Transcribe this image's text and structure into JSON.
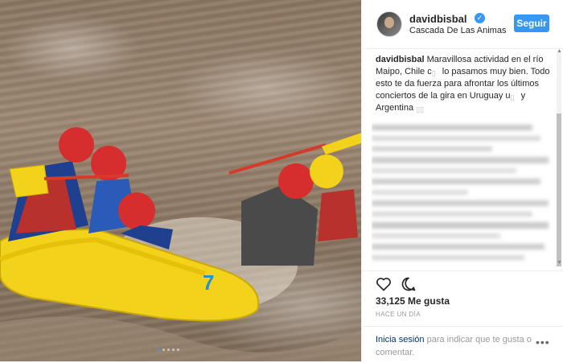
{
  "post": {
    "username": "davidbisbal",
    "verified_icon": "verified-badge-icon",
    "location": "Cascada De Las Animas",
    "follow_label": "Seguir",
    "caption_user": "davidbisbal",
    "caption_part1": "Maravillosa actividad en el río Maipo, Chile c",
    "caption_part2": " lo pasamos muy bien. Todo esto te da fuerza para afrontar los últimos conciertos de la gira en Uruguay u",
    "caption_part3": " y Argentina",
    "likes": "33,125 Me gusta",
    "time": "HACE UN DÍA",
    "login_link": "Inicia sesión",
    "login_text": " para indicar que te gusta o comentar.",
    "more_label": "•••"
  },
  "carousel": {
    "count": 5,
    "active": 0
  },
  "colors": {
    "accent": "#3897f0",
    "raft": "#f2d21a",
    "helmet": "#d62e2e",
    "water": "#8a7560"
  }
}
